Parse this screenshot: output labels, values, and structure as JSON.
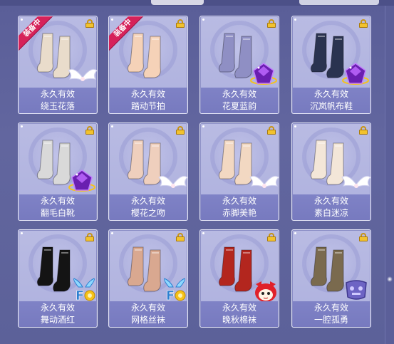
{
  "items": [
    {
      "validity": "永久有效",
      "name": "绕玉花落",
      "ribbon": "装备中",
      "badge": "wings-icon",
      "shoe_color": "#e9dccb",
      "locked": true
    },
    {
      "validity": "永久有效",
      "name": "踏动节拍",
      "ribbon": "装备中",
      "badge": "",
      "shoe_color": "#f5d2b8",
      "locked": true
    },
    {
      "validity": "永久有效",
      "name": "花夏蓝韵",
      "ribbon": "",
      "badge": "purple-gem-icon",
      "shoe_color": "#8f8fc4",
      "locked": true
    },
    {
      "validity": "永久有效",
      "name": "沉岚帆布鞋",
      "ribbon": "",
      "badge": "purple-gem-icon",
      "shoe_color": "#2a3350",
      "locked": true
    },
    {
      "validity": "永久有效",
      "name": "翻毛白靴",
      "ribbon": "",
      "badge": "purple-gem-icon",
      "shoe_color": "#d9d9d9",
      "locked": true
    },
    {
      "validity": "永久有效",
      "name": "樱花之吻",
      "ribbon": "",
      "badge": "wings-icon",
      "shoe_color": "#efcfbd",
      "locked": true
    },
    {
      "validity": "永久有效",
      "name": "赤脚美艳",
      "ribbon": "",
      "badge": "wings-icon",
      "shoe_color": "#f2d8c2",
      "locked": true
    },
    {
      "validity": "永久有效",
      "name": "素白迷凉",
      "ribbon": "",
      "badge": "wings-icon",
      "shoe_color": "#f3e6d8",
      "locked": true
    },
    {
      "validity": "永久有效",
      "name": "舞动酒红",
      "ribbon": "",
      "badge": "fashion-wings-icon",
      "shoe_color": "#141414",
      "locked": true
    },
    {
      "validity": "永久有效",
      "name": "网格丝袜",
      "ribbon": "",
      "badge": "fashion-wings-icon",
      "shoe_color": "#d9a890",
      "locked": true
    },
    {
      "validity": "永久有效",
      "name": "晚秋棉袜",
      "ribbon": "",
      "badge": "red-cat-mascot-icon",
      "shoe_color": "#b3261e",
      "locked": true
    },
    {
      "validity": "永久有效",
      "name": "一腔孤勇",
      "ribbon": "",
      "badge": "purple-emblem-icon",
      "shoe_color": "#7a6a4e",
      "locked": true
    }
  ]
}
